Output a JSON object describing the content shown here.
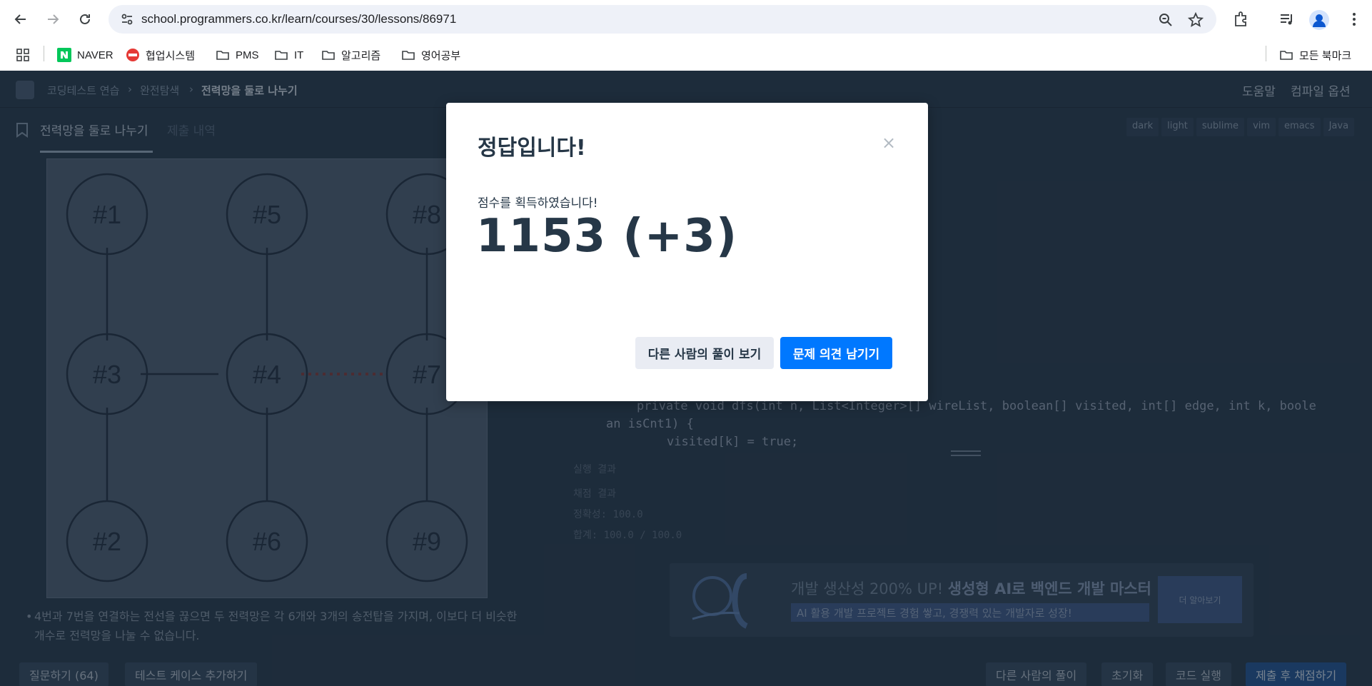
{
  "browser": {
    "url": "school.programmers.co.kr/learn/courses/30/lessons/86971",
    "bookmarks": [
      {
        "label": "NAVER",
        "icon": "naver-icon"
      },
      {
        "label": "협업시스템",
        "icon": "site-icon"
      },
      {
        "label": "PMS",
        "icon": "folder-icon"
      },
      {
        "label": "IT",
        "icon": "folder-icon"
      },
      {
        "label": "알고리즘",
        "icon": "folder-icon"
      },
      {
        "label": "영어공부",
        "icon": "folder-icon"
      }
    ],
    "all_bookmarks_label": "모든 북마크"
  },
  "site": {
    "breadcrumb": [
      "코딩테스트 연습",
      "완전탐색",
      "전력망을 둘로 나누기"
    ],
    "top_links": [
      "도움말",
      "컴파일 옵션"
    ],
    "tabs": [
      "전력망을 둘로 나누기",
      "제출 내역"
    ],
    "editor_options": [
      "dark",
      "light",
      "sublime",
      "vim",
      "emacs",
      "Java"
    ],
    "graph_nodes": [
      "#1",
      "#5",
      "#8",
      "#3",
      "#4",
      "#7",
      "#2",
      "#6",
      "#9"
    ],
    "description": "4번과 7번을 연결하는 전선을 끊으면 두 전력망은 각 6개와 3개의 송전탑을 가지며, 이보다 더 비슷한 개수로 전력망을 나눌 수 없습니다.",
    "code_line1": "private void dfs(int n, List<Integer>[] wireList, boolean[] visited, int[] edge, int k, boole",
    "code_line2": "an isCnt1) {",
    "code_line3": "visited[k] = true;",
    "result_header": "실행 결과",
    "result_lines": [
      "채점 결과",
      "정확성: 100.0",
      "합계: 100.0 / 100.0"
    ],
    "ad": {
      "headline_pre": "개발 생산성 200% UP! ",
      "headline_bold": "생성형 AI로 백엔드 개발 마스터",
      "sub": "AI 활용 개발 프로젝트 경험 쌓고, 경쟁력 있는 개발자로 성장!",
      "cta": "더 알아보기"
    },
    "bottom_left_buttons": [
      "질문하기 (64)",
      "테스트 케이스 추가하기"
    ],
    "bottom_right_buttons": [
      "다른 사람의 풀이",
      "초기화",
      "코드 실행",
      "제출 후 채점하기"
    ]
  },
  "modal": {
    "title": "정답입니다!",
    "message": "점수를 획득하였습니다!",
    "score": "1153 (+3)",
    "secondary_button": "다른 사람의 풀이 보기",
    "primary_button": "문제 의견 남기기",
    "close_symbol": "×",
    "primary_color": "#0078ff"
  }
}
